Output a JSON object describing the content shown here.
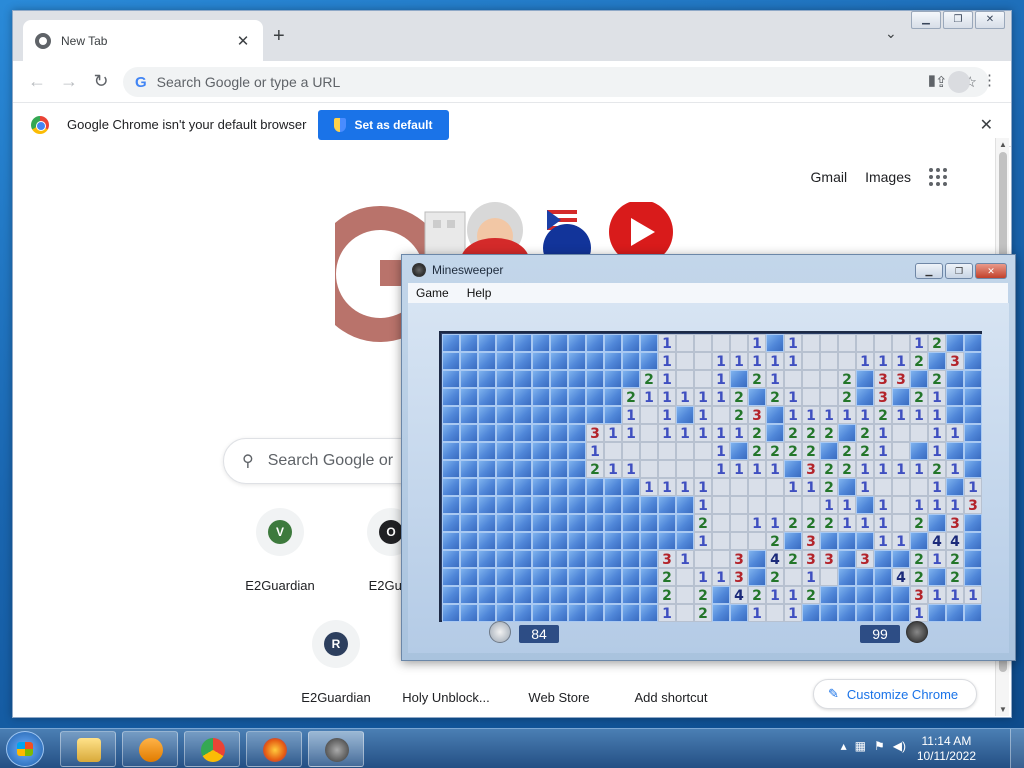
{
  "browser": {
    "tab_title": "New Tab",
    "omnibox_placeholder": "Search Google or type a URL",
    "infobar_text": "Google Chrome isn't your default browser",
    "set_default_label": "Set as default"
  },
  "ntp": {
    "gmail": "Gmail",
    "images": "Images",
    "search_placeholder": "Search Google or",
    "shortcuts": [
      {
        "label": "E2Guardian",
        "letter": "V",
        "color": "#3d7a3d"
      },
      {
        "label": "E2Guar",
        "letter": "O",
        "color": "#202124"
      },
      {
        "label": "E2Guardian",
        "letter": "R",
        "color": "#2d3f5e"
      },
      {
        "label": "Holy Unblock...",
        "letter": "",
        "color": "#ffffff"
      },
      {
        "label": "Web Store",
        "letter": "",
        "color": "#ffffff"
      },
      {
        "label": "Add shortcut",
        "letter": "",
        "color": "#ffffff"
      }
    ],
    "customize_label": "Customize Chrome"
  },
  "minesweeper": {
    "title": "Minesweeper",
    "menu": [
      "Game",
      "Help"
    ],
    "timer": "84",
    "mines_left": "99",
    "board": [
      "UUUUUUUUUUUU1....1U1......12U",
      "UUUUUUUUUUUU1..11111...1112U3",
      "UUUUUUUUUUU21..1U21...2U33U2",
      "UUUUUUUUUU2111112U21..2U3U21",
      "UUUUUUUUUU1.1U1.23U111112111",
      "UUUUUUUU311.111112U222U21..11",
      "UUUUUUUU1......1U2222U221.U1U",
      "UUUUUUUU211....1111U322111121",
      "UUUUUUUUUUU1111....112U1...1U1",
      "UUUUUUUUUUUUUU1......11U1.11132",
      "UUUUUUUUUUUUUU2..11222111.2U3U1",
      "UUUUUUUUUUUUUU1...2U3UUU11U44U221",
      "UUUUUUUUUUUU31..3U4233U3UU212U1",
      "UUUUUUUUUUUU2.113U2.1.UUU42U2U",
      "UUUUUUUUUUUU2.2U42112UUUUU3111",
      "UUUUUUUUUUUU1.2UU1.1UUUUUU1UUU"
    ]
  },
  "taskbar": {
    "time": "11:14 AM",
    "date": "10/11/2022"
  }
}
